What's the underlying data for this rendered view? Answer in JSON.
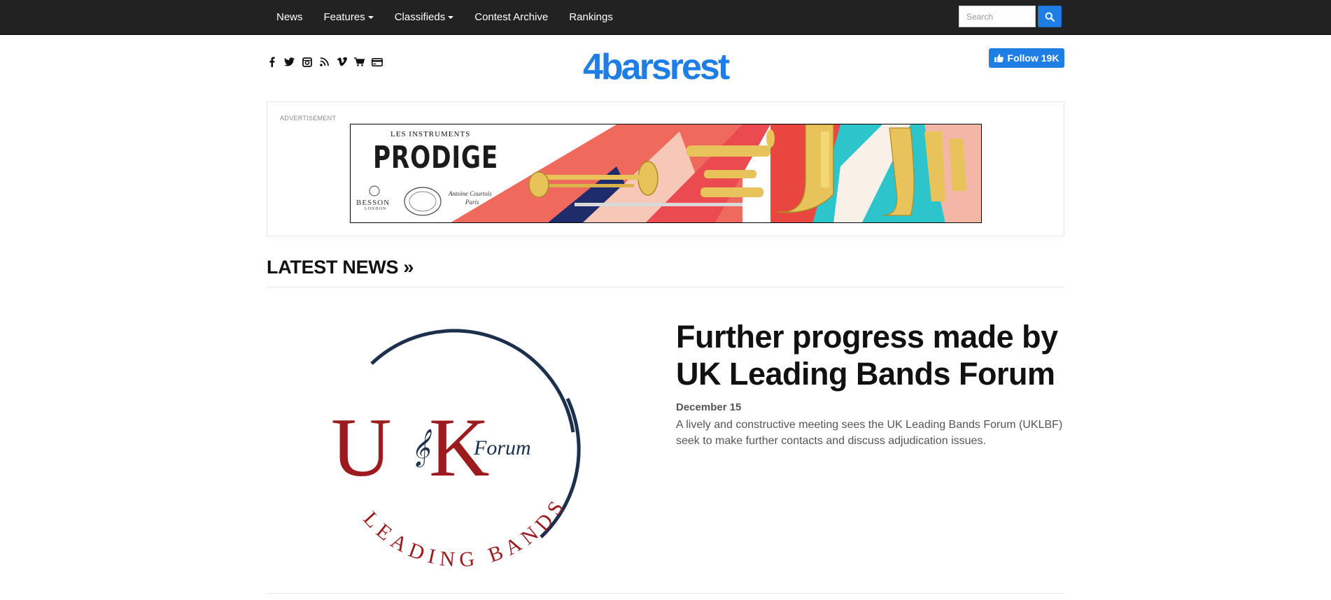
{
  "nav": {
    "items": [
      {
        "label": "News",
        "dropdown": false
      },
      {
        "label": "Features",
        "dropdown": true
      },
      {
        "label": "Classifieds",
        "dropdown": true
      },
      {
        "label": "Contest Archive",
        "dropdown": false
      },
      {
        "label": "Rankings",
        "dropdown": false
      }
    ],
    "search_placeholder": "Search",
    "search_icon": "search-icon"
  },
  "header": {
    "social_icons": [
      "facebook-icon",
      "twitter-icon",
      "instagram-icon",
      "rss-icon",
      "vimeo-icon",
      "cart-icon",
      "credit-card-icon"
    ],
    "logo": "4barsrest",
    "follow_label": "Follow 19K",
    "follow_icon": "thumbs-up-icon"
  },
  "ad": {
    "label": "ADVERTISEMENT",
    "banner_small": "LES INSTRUMENTS",
    "banner_big": "PRODIGE",
    "brands": [
      "BESSON",
      "LONDON",
      "Antoine Courtois",
      "Paris"
    ]
  },
  "latest_news": {
    "title": "LATEST NEWS »",
    "article": {
      "headline": "Further progress made by UK Leading Bands Forum",
      "date": "December 15",
      "summary": "A lively and constructive meeting sees the UK Leading Bands Forum (UKLBF) seek to make further contacts and discuss adjudication issues.",
      "image_text": {
        "letters_u": "U",
        "letters_k": "K",
        "forum": "Forum",
        "arc_text": "LEADING BANDS"
      }
    }
  },
  "colors": {
    "navbar": "#222222",
    "accent": "#1e7ee4",
    "logo_red": "#9b1b1e",
    "logo_navy": "#1c2f4d"
  }
}
